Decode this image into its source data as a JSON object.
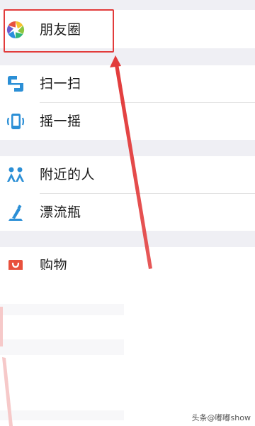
{
  "discover": {
    "items": [
      {
        "label": "朋友圈",
        "icon": "moments-aperture-icon"
      },
      {
        "label": "扫一扫",
        "icon": "scan-icon"
      },
      {
        "label": "摇一摇",
        "icon": "shake-phone-icon"
      },
      {
        "label": "附近的人",
        "icon": "people-nearby-icon"
      },
      {
        "label": "漂流瓶",
        "icon": "drift-bottle-icon"
      },
      {
        "label": "购物",
        "icon": "shopping-bag-icon"
      }
    ]
  },
  "watermark": "头条@嘟嘟show",
  "colors": {
    "highlight": "#e23b3b",
    "section_gap": "#efeff4",
    "icon_blue": "#2b8fd6"
  }
}
